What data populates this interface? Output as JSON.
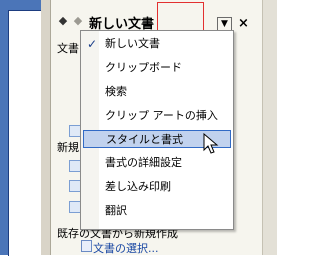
{
  "task_pane": {
    "title": "新しい文書",
    "back_icon": "◆",
    "forward_icon": "◆",
    "dropdown_icon": "▼",
    "close_icon": "×",
    "section_truncated_top": "文書",
    "section_truncated_mid": "新規",
    "from_existing_label": "既存の文書から新規作成",
    "select_document_link": "文書の選択..."
  },
  "menu": {
    "checkmark": "✓",
    "items": [
      {
        "label": "新しい文書",
        "checked": true
      },
      {
        "label": "クリップボード",
        "checked": false
      },
      {
        "label": "検索",
        "checked": false
      },
      {
        "label": "クリップ アートの挿入",
        "checked": false
      },
      {
        "label": "スタイルと書式",
        "checked": false,
        "hovered": true
      },
      {
        "label": "書式の詳細設定",
        "checked": false
      },
      {
        "label": "差し込み印刷",
        "checked": false
      },
      {
        "label": "翻訳",
        "checked": false
      }
    ]
  },
  "colors": {
    "hover_bg": "#c1d2ee",
    "hover_border": "#316ac5",
    "annotation_box": "#e23030",
    "link": "#1947a3"
  }
}
